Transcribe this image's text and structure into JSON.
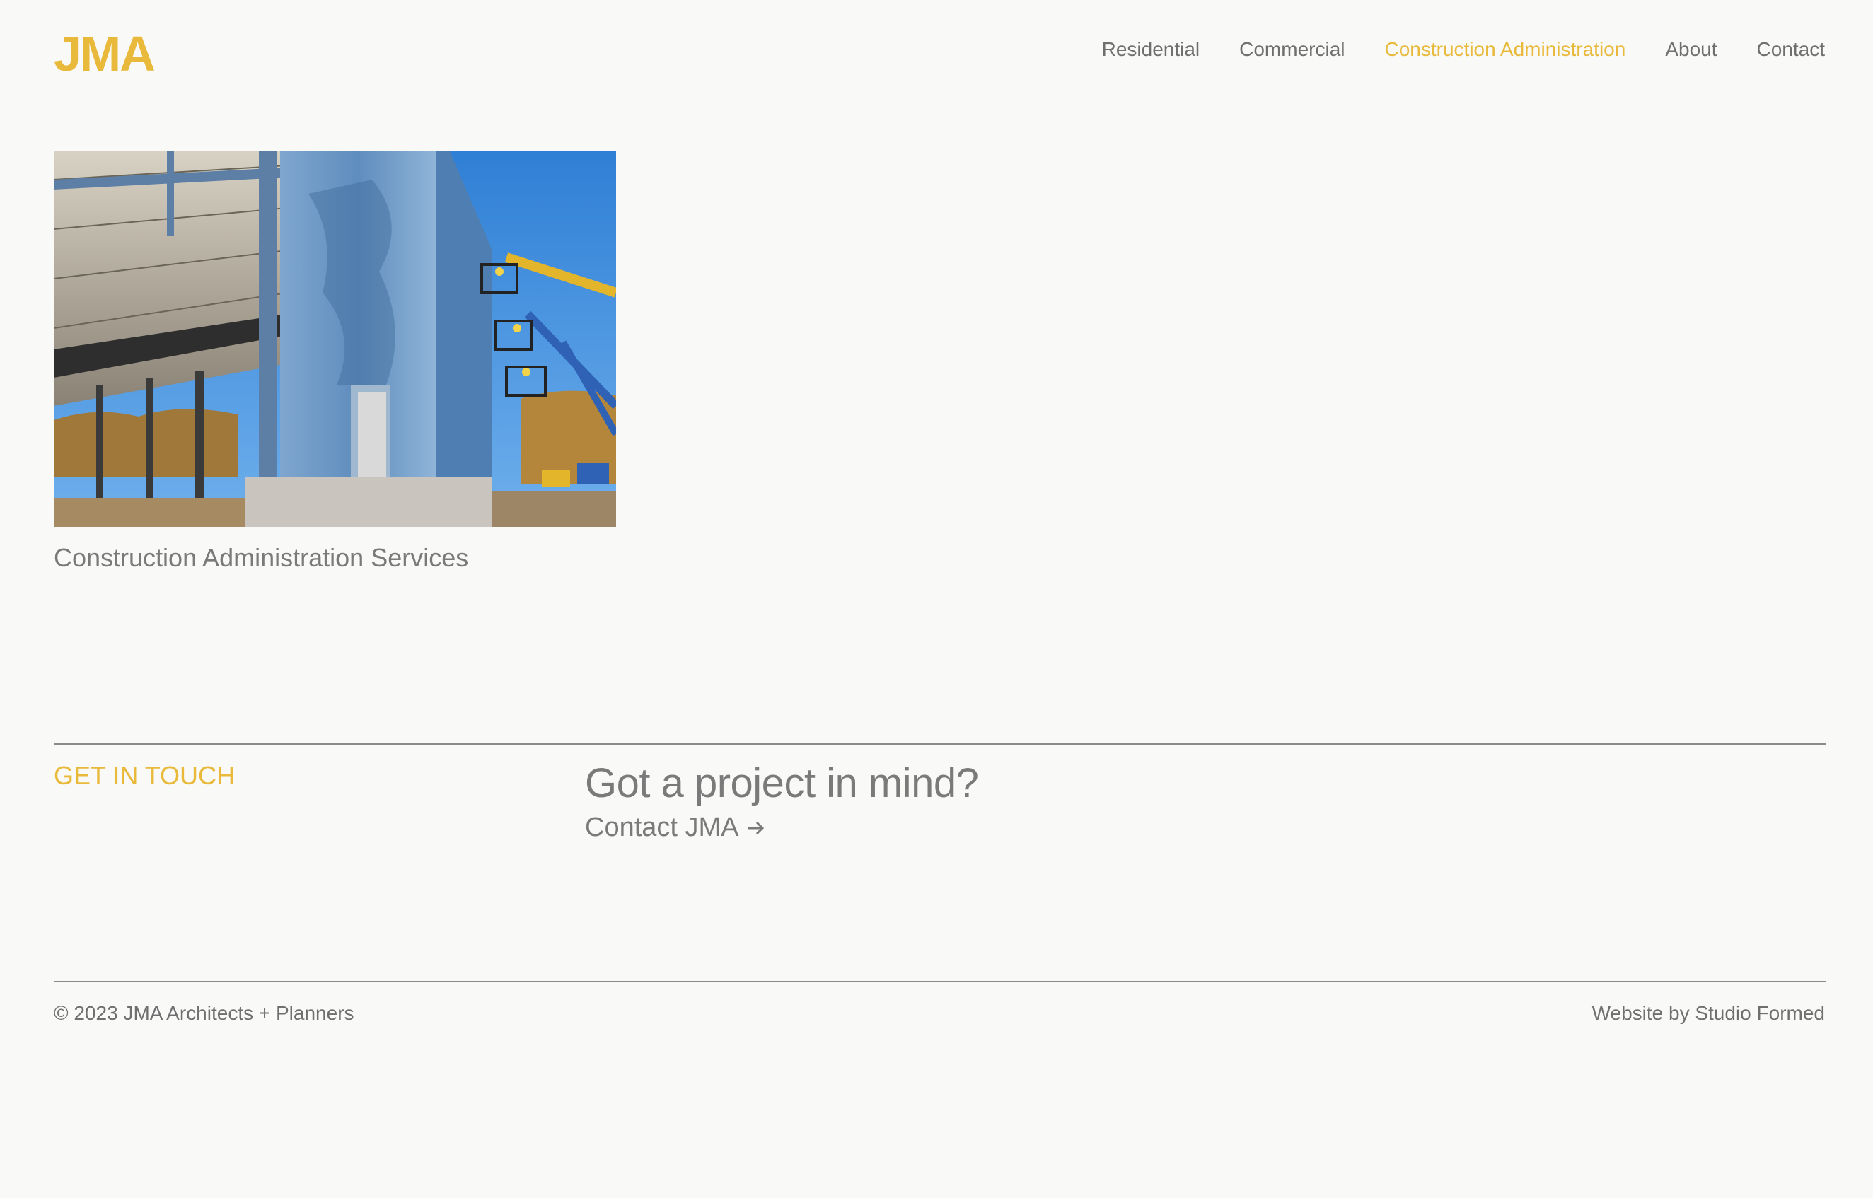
{
  "header": {
    "logo": "JMA",
    "brand_color": "#e8b93a",
    "nav": [
      {
        "label": "Residential",
        "active": false
      },
      {
        "label": "Commercial",
        "active": false
      },
      {
        "label": "Construction Administration",
        "active": true
      },
      {
        "label": "About",
        "active": false
      },
      {
        "label": "Contact",
        "active": false
      }
    ]
  },
  "main": {
    "projects": [
      {
        "title": "Construction Administration Services",
        "image": "construction-site-photo"
      }
    ]
  },
  "contact_section": {
    "label": "GET IN TOUCH",
    "heading": "Got a project in mind?",
    "link_label": "Contact JMA",
    "link_icon": "arrow-right-icon"
  },
  "footer": {
    "copyright": "© 2023 JMA Architects + Planners",
    "credit": "Website by Studio Formed"
  }
}
